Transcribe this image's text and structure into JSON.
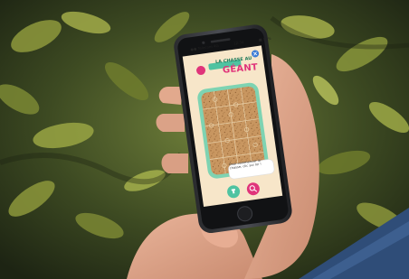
{
  "status_bar": {
    "carrier": "●● Telecom 4G",
    "time": "12:34",
    "battery": "■ 87%"
  },
  "game": {
    "logo_line1": "LA CHASSE AU",
    "logo_line2": "GÉANT",
    "hint_text": "Pour commencer la chasse, clic sur loi !",
    "close_icon": "close-icon",
    "puzzle_button_icon": "puzzle-icon",
    "search_button_icon": "magnifier-icon"
  },
  "colors": {
    "accent_pink": "#e0347a",
    "accent_green": "#4fc3a1",
    "puzzle_tan": "#c89660",
    "screen_bg": "#f7e6c9"
  }
}
